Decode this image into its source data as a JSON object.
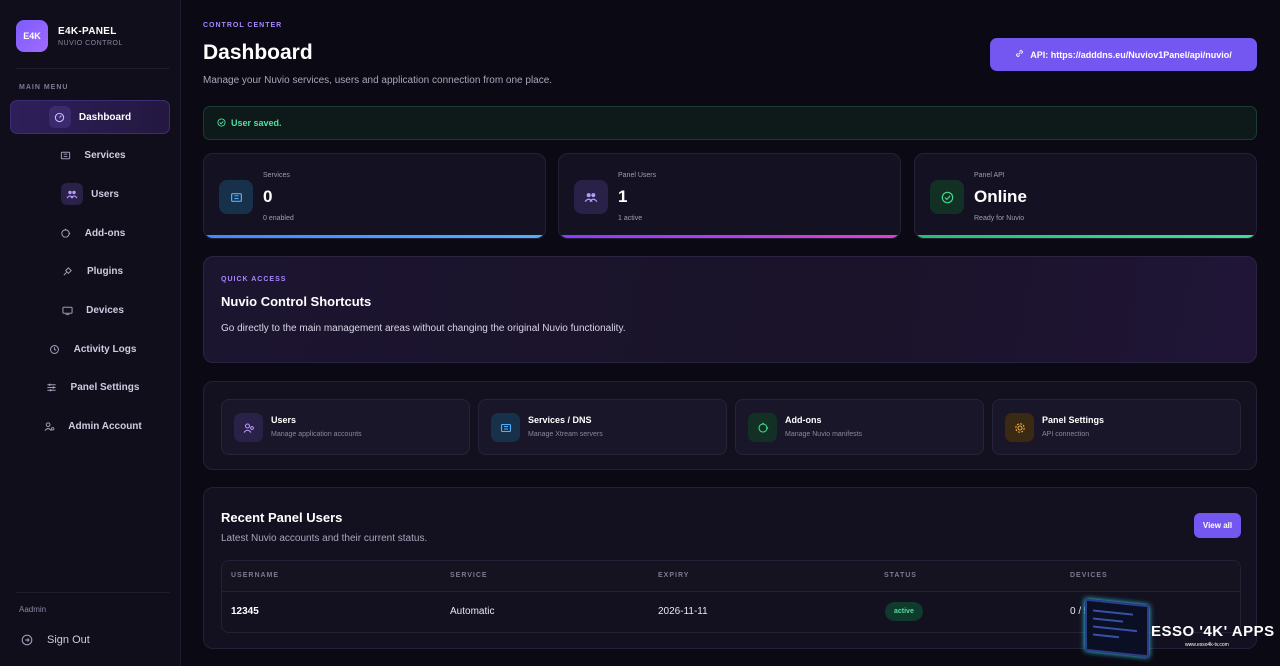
{
  "brand": {
    "logo": "E4K",
    "name": "E4K-PANEL",
    "subtitle": "NUVIO CONTROL"
  },
  "sidebar": {
    "menu_label": "MAIN MENU",
    "items": [
      {
        "label": "Dashboard",
        "icon": "gauge-icon"
      },
      {
        "label": "Services",
        "icon": "server-icon"
      },
      {
        "label": "Users",
        "icon": "users-icon"
      },
      {
        "label": "Add-ons",
        "icon": "puzzle-icon"
      },
      {
        "label": "Plugins",
        "icon": "plug-icon"
      },
      {
        "label": "Devices",
        "icon": "monitor-icon"
      },
      {
        "label": "Activity Logs",
        "icon": "history-icon"
      },
      {
        "label": "Panel Settings",
        "icon": "sliders-icon"
      },
      {
        "label": "Admin Account",
        "icon": "user-cog-icon"
      }
    ],
    "user": "admin",
    "sign_out": "Sign Out"
  },
  "header": {
    "eyebrow": "CONTROL CENTER",
    "title": "Dashboard",
    "description": "Manage your Nuvio services, users and application connection from one place.",
    "api_button": "API: https://adddns.eu/Nuviov1Panel/api/nuvio/"
  },
  "alert": {
    "message": "User saved."
  },
  "stats": [
    {
      "label": "Services",
      "value": "0",
      "sub": "0 enabled",
      "color": "#3d8bff"
    },
    {
      "label": "Panel Users",
      "value": "1",
      "sub": "1 active",
      "color": "#c040ff"
    },
    {
      "label": "Panel API",
      "value": "Online",
      "sub": "Ready for Nuvio",
      "color": "#2fd080"
    }
  ],
  "quick": {
    "eyebrow": "QUICK ACCESS",
    "title": "Nuvio Control Shortcuts",
    "description": "Go directly to the main management areas without changing the original Nuvio functionality."
  },
  "shortcuts": [
    {
      "title": "Users",
      "sub": "Manage application accounts"
    },
    {
      "title": "Services / DNS",
      "sub": "Manage Xtream servers"
    },
    {
      "title": "Add-ons",
      "sub": "Manage Nuvio manifests"
    },
    {
      "title": "Panel Settings",
      "sub": "API connection"
    }
  ],
  "recent": {
    "title": "Recent Panel Users",
    "description": "Latest Nuvio accounts and their current status.",
    "view_all": "View all",
    "columns": [
      "USERNAME",
      "SERVICE",
      "EXPIRY",
      "STATUS",
      "DEVICES"
    ],
    "rows": [
      {
        "username": "12345",
        "service": "Automatic",
        "expiry": "2026-11-11",
        "status": "active",
        "devices": "0 / 5"
      }
    ]
  },
  "watermark": {
    "text": "ESSO '4K' APPS",
    "url": "www.esso4k-tv.com"
  }
}
